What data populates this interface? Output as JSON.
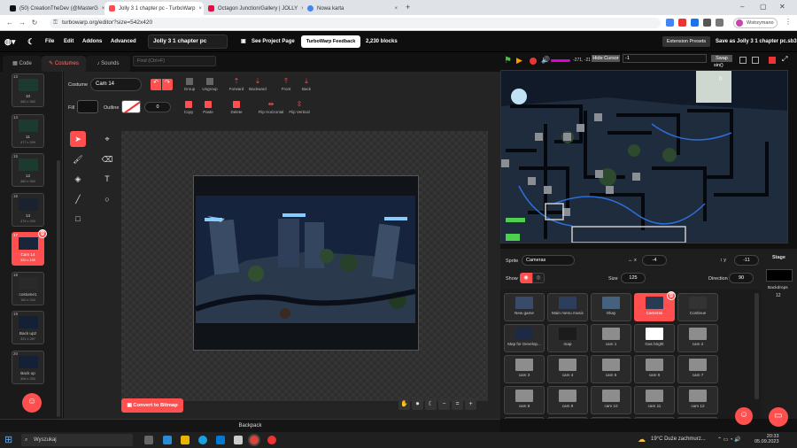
{
  "browser": {
    "tabs": [
      {
        "title": "(50) CreationTheDev (@MasterG",
        "color": "#111"
      },
      {
        "title": "Jolly 3 1 chapter pc - TurboWarp",
        "color": "#ff4c4c"
      },
      {
        "title": "Octagon Junction/Gallery | JOLLY",
        "color": "#d14"
      },
      {
        "title": "Nowa karta",
        "color": "#4285f4"
      }
    ],
    "url": "turbowarp.org/editor?size=542x420",
    "profile": "Wstrzymano"
  },
  "menubar": {
    "file": "File",
    "edit": "Edit",
    "addons": "Addons",
    "advanced": "Advanced",
    "project_title": "Jolly 3 1 chapter pc",
    "see_project": "See Project Page",
    "feedback": "TurboWarp Feedback",
    "blocks": "2,230 blocks",
    "ext_presets": "Extension Presets",
    "save_as": "Save as Jolly 3 1 chapter pc.sb3"
  },
  "editor_tabs": {
    "code": "Code",
    "costumes": "Costumes",
    "sounds": "Sounds"
  },
  "find_placeholder": "Find (Ctrl+F)",
  "costumes": [
    {
      "num": "13",
      "name": "10",
      "dim": "480 x 360"
    },
    {
      "num": "14",
      "name": "11",
      "dim": "477 x 399"
    },
    {
      "num": "15",
      "name": "12",
      "dim": "480 x 360"
    },
    {
      "num": "16",
      "name": "13",
      "dim": "476 x 300"
    },
    {
      "num": "17",
      "name": "Cam 14",
      "dim": "320 x 195",
      "selected": true
    },
    {
      "num": "18",
      "name": "costume1",
      "dim": "160 x 244"
    },
    {
      "num": "19",
      "name": "Back up2",
      "dim": "321 x 287"
    },
    {
      "num": "20",
      "name": "Back up",
      "dim": "306 x 284"
    }
  ],
  "paint": {
    "costume_label": "Costume",
    "costume_name": "Cam 14",
    "fill_label": "Fill",
    "outline_label": "Outline",
    "outline_width": "0",
    "buttons": {
      "group": "Group",
      "ungroup": "Ungroup",
      "forward": "Forward",
      "backward": "Backward",
      "front": "Front",
      "back": "Back",
      "copy": "Copy",
      "paste": "Paste",
      "delete": "Delete",
      "flip_h": "Flip Horizontal",
      "flip_v": "Flip Vertical"
    },
    "convert_bitmap": "Convert to Bitmap",
    "zoom_reset": "="
  },
  "stage": {
    "hide_cursor": "Hide Cursor",
    "input_value": "-1",
    "swap": "Swap",
    "sin": "sin()",
    "zero": "0",
    "readout": "-271, -21"
  },
  "sprite_info": {
    "sprite_label": "Sprite",
    "sprite_name": "Cameras",
    "x": "-4",
    "y": "-11",
    "show_label": "Show",
    "size_label": "Size",
    "size": "125",
    "direction_label": "Direction",
    "direction": "90"
  },
  "sprites": [
    {
      "name": "New game"
    },
    {
      "name": "Main menu music"
    },
    {
      "name": "Okay"
    },
    {
      "name": "Cameras",
      "selected": true
    },
    {
      "name": "Continue"
    },
    {
      "name": "Map for Develop..."
    },
    {
      "name": "map"
    },
    {
      "name": "cam 1"
    },
    {
      "name": "Gas bright"
    },
    {
      "name": "cam 2"
    },
    {
      "name": "cam 3"
    },
    {
      "name": "cam 4"
    },
    {
      "name": "cam 5"
    },
    {
      "name": "cam 6"
    },
    {
      "name": "cam 7"
    },
    {
      "name": "cam 8"
    },
    {
      "name": "cam 9"
    },
    {
      "name": "cam 10"
    },
    {
      "name": "cam 11"
    },
    {
      "name": "cam 12"
    },
    {
      "name": ""
    },
    {
      "name": ""
    },
    {
      "name": ""
    },
    {
      "name": ""
    },
    {
      "name": ""
    }
  ],
  "stage_panel": {
    "label": "Stage",
    "backdrops_label": "Backdrops",
    "backdrops_count": "12"
  },
  "backpack": "Backpack",
  "taskbar": {
    "search": "Wyszukaj",
    "weather": "19°C  Duże zachmurz...",
    "time": "20:33",
    "date": "05.09.2023"
  },
  "colors": {
    "accent": "#ff4f4f",
    "bg": "#111111"
  }
}
